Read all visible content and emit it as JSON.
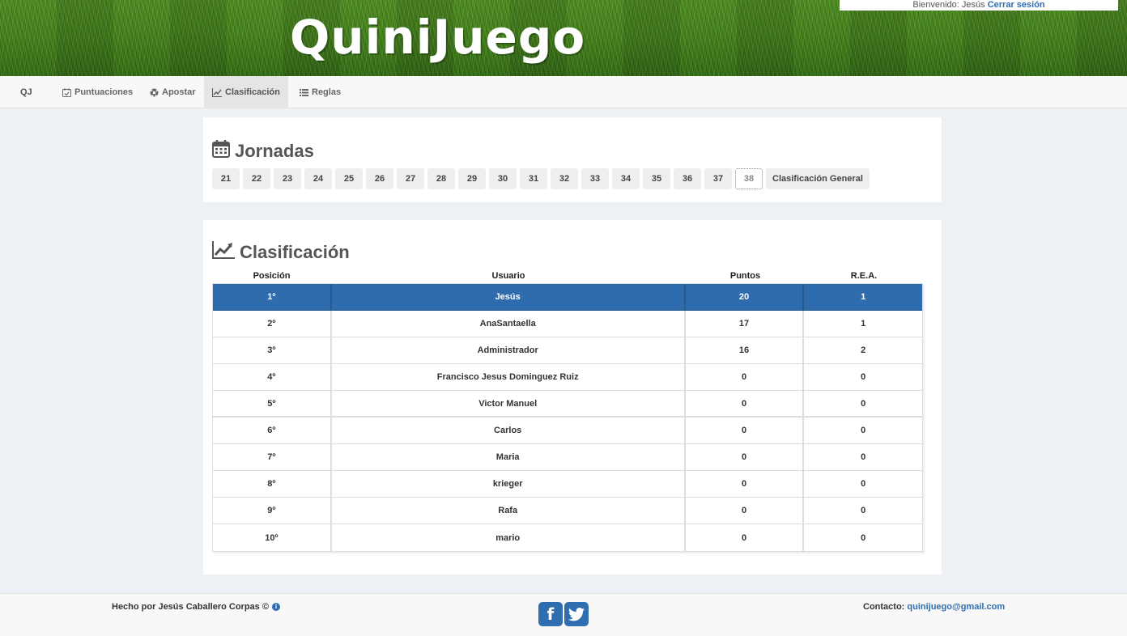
{
  "header": {
    "logo": "QuiniJuego",
    "welcome_text": "Bienvenido: Jesús",
    "logout_label": "Cerrar sesión"
  },
  "nav": {
    "brand": "QJ",
    "items": [
      {
        "label": "Puntuaciones",
        "icon": "calendar-check-icon"
      },
      {
        "label": "Apostar",
        "icon": "soccer-ball-icon"
      },
      {
        "label": "Clasificación",
        "icon": "line-chart-icon",
        "active": true
      },
      {
        "label": "Reglas",
        "icon": "list-icon"
      }
    ]
  },
  "jornadas": {
    "title": "Jornadas",
    "buttons": [
      "21",
      "22",
      "23",
      "24",
      "25",
      "26",
      "27",
      "28",
      "29",
      "30",
      "31",
      "32",
      "33",
      "34",
      "35",
      "36",
      "37",
      "38"
    ],
    "current": "38",
    "general_label": "Clasificación General"
  },
  "clasificacion": {
    "title": "Clasificación",
    "headers": [
      "Posición",
      "Usuario",
      "Puntos",
      "R.E.A."
    ],
    "rows": [
      {
        "pos": "1º",
        "user": "Jesús",
        "points": "20",
        "rea": "1"
      },
      {
        "pos": "2º",
        "user": "AnaSantaella",
        "points": "17",
        "rea": "1"
      },
      {
        "pos": "3º",
        "user": "Administrador",
        "points": "16",
        "rea": "2"
      },
      {
        "pos": "4º",
        "user": "Francisco Jesus Dominguez Ruiz",
        "points": "0",
        "rea": "0"
      },
      {
        "pos": "5º",
        "user": "Victor Manuel",
        "points": "0",
        "rea": "0"
      },
      {
        "pos": "6º",
        "user": "Carlos",
        "points": "0",
        "rea": "0"
      },
      {
        "pos": "7º",
        "user": "Maria",
        "points": "0",
        "rea": "0"
      },
      {
        "pos": "8º",
        "user": "krieger",
        "points": "0",
        "rea": "0"
      },
      {
        "pos": "9º",
        "user": "Rafa",
        "points": "0",
        "rea": "0"
      },
      {
        "pos": "10º",
        "user": "mario",
        "points": "0",
        "rea": "0"
      }
    ]
  },
  "footer": {
    "made_by": "Hecho por Jesús Caballero Corpas ©",
    "contact_label": "Contacto:",
    "contact_email": "quinijuego@gmail.com"
  },
  "colors": {
    "accent": "#2f6cad",
    "link": "#2f6db2",
    "background": "#edf0f4"
  }
}
